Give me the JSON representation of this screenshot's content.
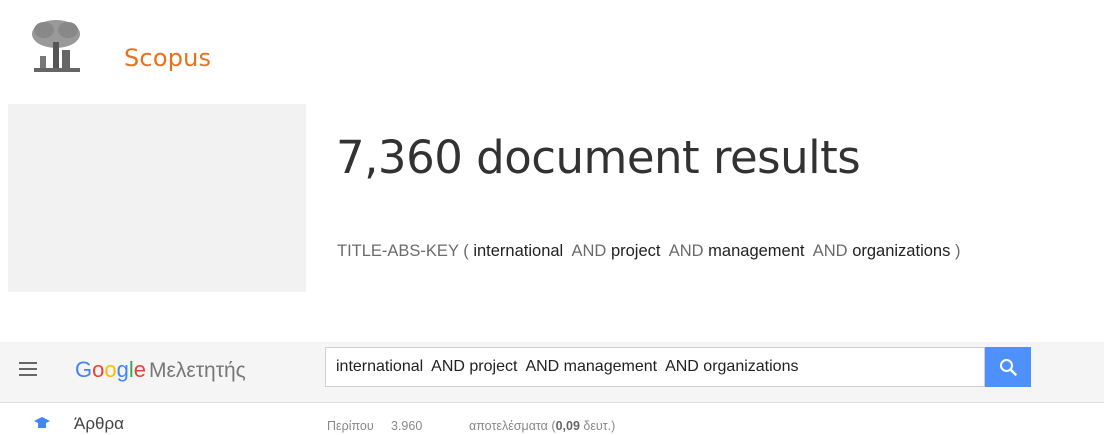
{
  "scopus": {
    "brand": "Scopus",
    "results_title": "7,360 document results",
    "query": {
      "prefix": "TITLE-ABS-KEY (",
      "terms": [
        "international",
        "project",
        "management",
        "organizations"
      ],
      "operator": "AND",
      "suffix": ")"
    }
  },
  "scholar": {
    "logo_google": [
      "G",
      "o",
      "o",
      "g",
      "l",
      "e"
    ],
    "logo_word": "Μελετητής",
    "search_value": "international  AND project  AND management  AND organizations",
    "left_nav_label": "Άρθρα",
    "about_label": "Περίπου",
    "about_count": "3.960",
    "results_prefix": "αποτελέσματα (",
    "results_time": "0,09",
    "results_suffix": " δευτ.)",
    "colors": {
      "search_button": "#4d90fe",
      "brand_orange": "#e9711c"
    }
  }
}
